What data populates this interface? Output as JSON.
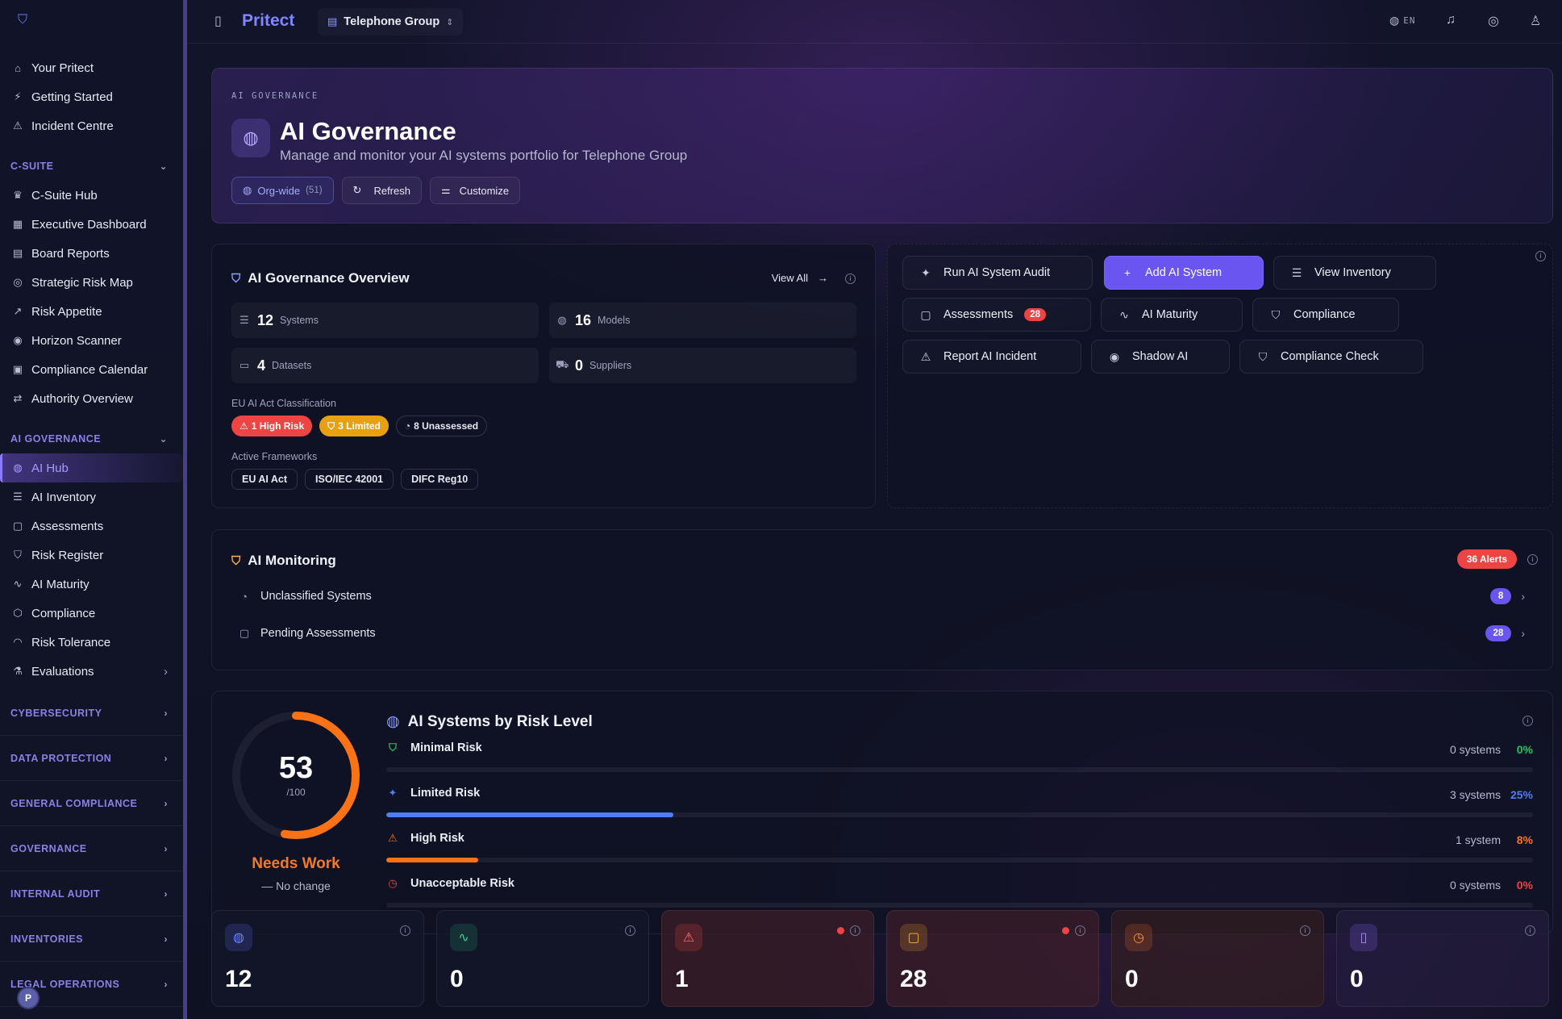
{
  "app": {
    "brand": "Pritect",
    "workspace": "Telephone Group",
    "lang": "EN"
  },
  "sidebar": {
    "top": [
      {
        "icon": "⌂",
        "label": "Your Pritect"
      },
      {
        "icon": "⚡",
        "label": "Getting Started"
      },
      {
        "icon": "⚠",
        "label": "Incident Centre"
      }
    ],
    "csuite_label": "C-SUITE",
    "csuite": [
      {
        "icon": "♛",
        "label": "C-Suite Hub"
      },
      {
        "icon": "▦",
        "label": "Executive Dashboard"
      },
      {
        "icon": "▤",
        "label": "Board Reports"
      },
      {
        "icon": "◎",
        "label": "Strategic Risk Map"
      },
      {
        "icon": "↗",
        "label": "Risk Appetite"
      },
      {
        "icon": "◉",
        "label": "Horizon Scanner"
      },
      {
        "icon": "▣",
        "label": "Compliance Calendar"
      },
      {
        "icon": "⇄",
        "label": "Authority Overview"
      }
    ],
    "ai_label": "AI GOVERNANCE",
    "ai": [
      {
        "icon": "◍",
        "label": "AI Hub"
      },
      {
        "icon": "☰",
        "label": "AI Inventory"
      },
      {
        "icon": "▢",
        "label": "Assessments"
      },
      {
        "icon": "⛉",
        "label": "Risk Register"
      },
      {
        "icon": "∿",
        "label": "AI Maturity"
      },
      {
        "icon": "⬡",
        "label": "Compliance"
      },
      {
        "icon": "◠",
        "label": "Risk Tolerance"
      },
      {
        "icon": "⚗",
        "label": "Evaluations"
      }
    ],
    "sections": [
      "CYBERSECURITY",
      "DATA PROTECTION",
      "GENERAL COMPLIANCE",
      "GOVERNANCE",
      "INTERNAL AUDIT",
      "INVENTORIES",
      "LEGAL OPERATIONS"
    ]
  },
  "hero": {
    "kicker": "AI GOVERNANCE",
    "title": "AI Governance",
    "subtitle": "Manage and monitor your AI systems portfolio for Telephone Group",
    "org_label": "Org-wide",
    "org_count": "(51)",
    "refresh": "Refresh",
    "customize": "Customize"
  },
  "overview": {
    "title": "AI Governance Overview",
    "view_all": "View All",
    "stats": [
      {
        "n": "12",
        "l": "Systems"
      },
      {
        "n": "16",
        "l": "Models"
      },
      {
        "n": "4",
        "l": "Datasets"
      },
      {
        "n": "0",
        "l": "Suppliers"
      }
    ],
    "eu_label": "EU AI Act Classification",
    "high": "1 High Risk",
    "limited": "3 Limited",
    "unassessed": "8 Unassessed",
    "fw_label": "Active Frameworks",
    "frameworks": [
      "EU AI Act",
      "ISO/IEC 42001",
      "DIFC Reg10"
    ]
  },
  "actions": {
    "audit": "Run AI System Audit",
    "add": "Add AI System",
    "inventory": "View Inventory",
    "assessments": "Assessments",
    "assess_count": "28",
    "maturity": "AI Maturity",
    "compliance": "Compliance",
    "incident": "Report AI Incident",
    "shadow": "Shadow AI",
    "check": "Compliance Check"
  },
  "monitoring": {
    "title": "AI Monitoring",
    "alerts": "36 Alerts",
    "rows": [
      {
        "label": "Unclassified Systems",
        "count": "8"
      },
      {
        "label": "Pending Assessments",
        "count": "28"
      }
    ]
  },
  "risk": {
    "score": "53",
    "den": "/100",
    "score_value": 53,
    "status": "Needs Work",
    "change": "— No change",
    "title": "AI Systems by Risk Level",
    "levels": [
      {
        "name": "Minimal Risk",
        "systems": "0 systems",
        "pct": "0%",
        "value": 0,
        "color": "#22c55e"
      },
      {
        "name": "Limited Risk",
        "systems": "3 systems",
        "pct": "25%",
        "value": 25,
        "color": "#4f7df3"
      },
      {
        "name": "High Risk",
        "systems": "1 system",
        "pct": "8%",
        "value": 8,
        "color": "#f97316"
      },
      {
        "name": "Unacceptable Risk",
        "systems": "0 systems",
        "pct": "0%",
        "value": 0,
        "color": "#ef4444"
      }
    ]
  },
  "kpis": [
    {
      "n": "12",
      "color": "#6f84ff",
      "bg": "rgba(80,100,220,.22)",
      "icon": "◍"
    },
    {
      "n": "0",
      "color": "#34d399",
      "bg": "rgba(30,150,100,.22)",
      "icon": "∿"
    },
    {
      "n": "1",
      "color": "#f87171",
      "bg": "rgba(200,60,60,.25)",
      "icon": "⚠"
    },
    {
      "n": "28",
      "color": "#f5b342",
      "bg": "rgba(200,140,40,.25)",
      "icon": "▢"
    },
    {
      "n": "0",
      "color": "#fb923c",
      "bg": "rgba(200,90,40,.25)",
      "icon": "◷"
    },
    {
      "n": "0",
      "color": "#a78bfa",
      "bg": "rgba(120,90,220,.25)",
      "icon": "▯"
    }
  ]
}
